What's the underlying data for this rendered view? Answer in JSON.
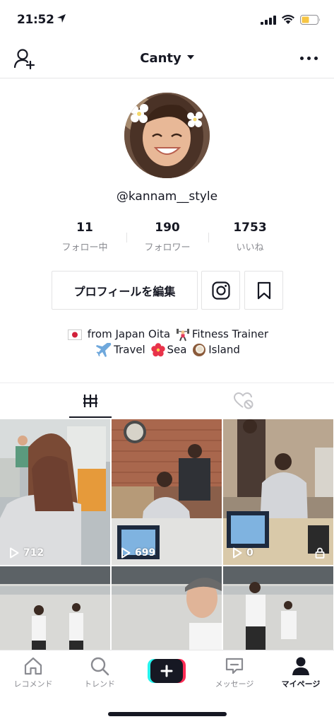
{
  "status_bar": {
    "time": "21:52"
  },
  "header": {
    "title": "Canty"
  },
  "profile": {
    "username": "@kannam__style",
    "stats": [
      {
        "value": "11",
        "label": "フォロー中"
      },
      {
        "value": "190",
        "label": "フォロワー"
      },
      {
        "value": "1753",
        "label": "いいね"
      }
    ],
    "edit_label": "プロフィールを編集",
    "bio": {
      "line1_a": "from Japan Oita",
      "line1_b": "Fitness Trainer",
      "line2_a": "Travel",
      "line2_b": "Sea",
      "line2_c": "Island"
    }
  },
  "videos": [
    {
      "views": "712"
    },
    {
      "views": "699"
    },
    {
      "views": "0"
    }
  ],
  "nav": [
    {
      "label": "レコメンド",
      "icon": "home-icon"
    },
    {
      "label": "トレンド",
      "icon": "search-icon"
    },
    {
      "label": "",
      "icon": "create-icon"
    },
    {
      "label": "メッセージ",
      "icon": "message-icon"
    },
    {
      "label": "マイページ",
      "icon": "profile-icon"
    }
  ],
  "colors": {
    "accent_pink": "#fe2c55",
    "accent_cyan": "#25f4ee",
    "text": "#161823",
    "muted": "#8a8b91"
  }
}
